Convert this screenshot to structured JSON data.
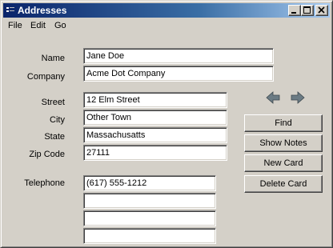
{
  "window": {
    "title": "Addresses",
    "controls": [
      "minimize-icon",
      "maximize-icon",
      "close-icon"
    ]
  },
  "menu": {
    "file": "File",
    "edit": "Edit",
    "go": "Go"
  },
  "form": {
    "name_label": "Name",
    "name_value": "Jane Doe",
    "company_label": "Company",
    "company_value": "Acme Dot Company",
    "street_label": "Street",
    "street_value": "12 Elm Street",
    "city_label": "City",
    "city_value": "Other Town",
    "state_label": "State",
    "state_value": "Massachusatts",
    "zip_label": "Zip Code",
    "zip_value": "27111",
    "telephone_label": "Telephone",
    "phones": [
      "(617) 555-1212",
      "",
      "",
      ""
    ]
  },
  "nav": {
    "prev_icon": "arrow-left-icon",
    "next_icon": "arrow-right-icon"
  },
  "buttons": {
    "find": "Find",
    "show_notes": "Show Notes",
    "new_card": "New Card",
    "delete_card": "Delete Card"
  },
  "colors": {
    "face": "#d4d0c8",
    "title_start": "#0a246a",
    "title_end": "#a6caf0",
    "arrow": "#6b7b84"
  }
}
